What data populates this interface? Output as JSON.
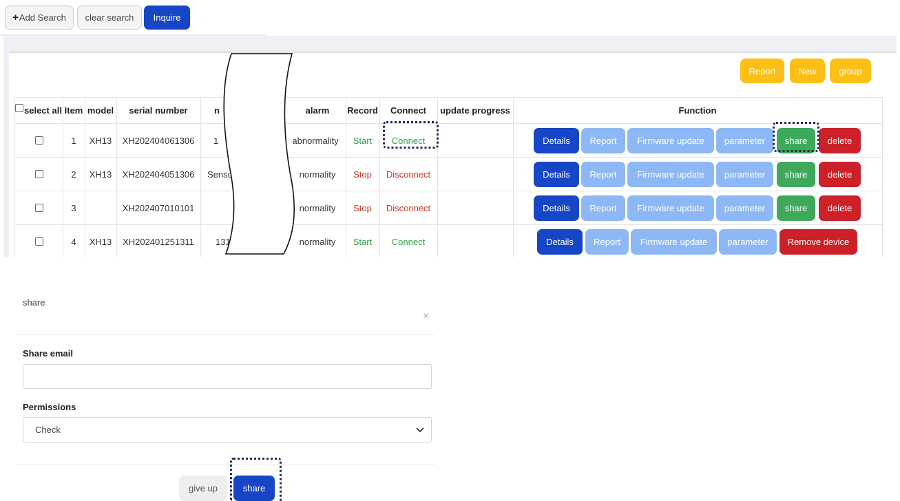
{
  "toolbar": {
    "add_search": "Add Search",
    "clear_search": "clear search",
    "inquire": "Inquire"
  },
  "panel_actions": {
    "report": "Report",
    "new": "New",
    "group": "group"
  },
  "table": {
    "headers": {
      "select_all": "select all",
      "item": "Item",
      "model": "model",
      "serial_number": "serial number",
      "name_partial": "n",
      "alarm": "alarm",
      "record": "Record",
      "connect": "Connect",
      "update_progress": "update progress",
      "function": "Function"
    },
    "rows": [
      {
        "item": "1",
        "model": "XH13",
        "serial": "XH202404061306",
        "name": "1",
        "alarm": "abnormality",
        "record": "Start",
        "connect": "Connect"
      },
      {
        "item": "2",
        "model": "XH13",
        "serial": "XH202404051306",
        "name": "Senso",
        "alarm": "normality",
        "record": "Stop",
        "connect": "Disconnect"
      },
      {
        "item": "3",
        "model": "",
        "serial": "XH202407010101",
        "name": "",
        "alarm": "normality",
        "record": "Stop",
        "connect": "Disconnect"
      },
      {
        "item": "4",
        "model": "XH13",
        "serial": "XH202401251311",
        "name": "131",
        "alarm": "normality",
        "record": "Start",
        "connect": "Connect"
      }
    ],
    "functions": {
      "details": "Details",
      "report": "Report",
      "firmware_update": "Firmware update",
      "parameter": "parameter",
      "share": "share",
      "delete": "delete",
      "remove_device": "Remove device"
    }
  },
  "modal": {
    "title": "share",
    "close": "×",
    "email_label": "Share email",
    "email_value": "",
    "permissions_label": "Permissions",
    "permissions_value": "Check",
    "give_up": "give up",
    "share": "share"
  },
  "colors": {
    "primary": "#1646c5",
    "light_blue": "#8eb8f5",
    "green": "#3ea95b",
    "red": "#cc2128",
    "yellow": "#fbbf16",
    "highlight_border": "#1a2a5c"
  }
}
